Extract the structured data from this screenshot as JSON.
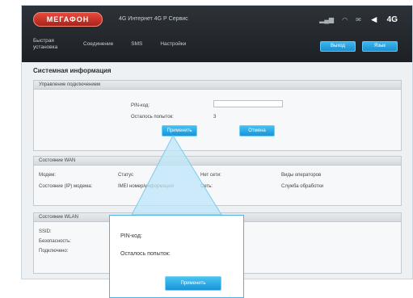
{
  "header": {
    "logo_text": "МЕГАФОН",
    "network_text": "4G Интернет 4G Р Сервис",
    "status_icons": [
      "signal-icon",
      "wifi-icon",
      "sms-icon"
    ],
    "brand_text": "4G",
    "arrow_icon": "arrow-left-icon"
  },
  "nav": {
    "items": [
      {
        "label": "Быстрая установка"
      },
      {
        "label": "Соединение"
      },
      {
        "label": "SMS"
      },
      {
        "label": "Настройки"
      }
    ]
  },
  "actions": {
    "btn1": "Выход",
    "btn2": "Язык"
  },
  "page": {
    "title": "Системная информация"
  },
  "panel1": {
    "header": "Управление подключением",
    "pin_label": "PIN-код:",
    "attempts_label": "Осталось попыток:",
    "attempts_value": "3",
    "apply_btn": "Применить",
    "cancel_btn": "Отмена"
  },
  "panel2": {
    "header": "Состояние WAN",
    "r1c1": "Модем:",
    "r1c2": "Статус",
    "r1c3": "Нет сети:",
    "r1c4": "Виды операторов",
    "r2c1": "Состояние (IP) модема:",
    "r2c2": "IMEI номер/информация",
    "r2c3": "Сеть:",
    "r2c4": "Служба обработки"
  },
  "panel3": {
    "header": "Состояние WLAN",
    "rows": [
      "SSID:",
      "Безопасность:",
      "Подключено:"
    ]
  },
  "popup": {
    "pin_label": "PIN-код:",
    "attempts_label": "Осталось попыток:",
    "button": "Применить"
  },
  "colors": {
    "accent": "#1b94d6",
    "header_bg": "#2d3238",
    "logo_red": "#d8382b"
  }
}
